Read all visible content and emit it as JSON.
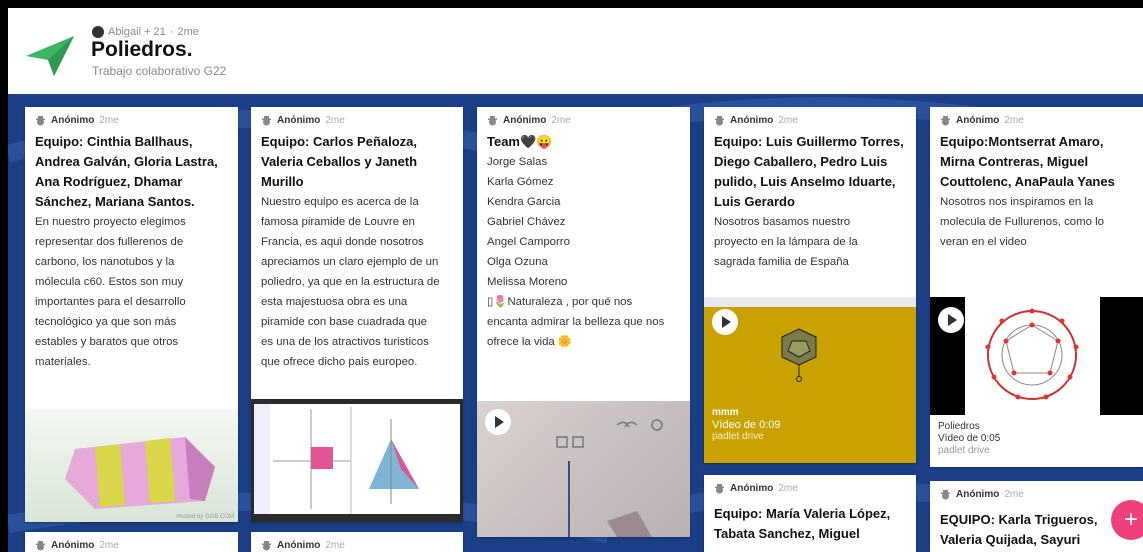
{
  "header": {
    "author": "Abigail + 21",
    "time": "2me",
    "title": "Poliedros.",
    "subtitle": "Trabajo colaborativo G22"
  },
  "cards": [
    {
      "author": "Anónimo",
      "time": "2me",
      "title_lines": [
        "Equipo: Cinthia Ballhaus,",
        "Andrea Galván, Gloria Lastra,",
        "Ana Rodríguez, Dhamar",
        "Sánchez, Mariana Santos."
      ],
      "body_lines": [
        "En nuestro proyecto elegimos",
        "representar dos fullerenos de",
        "carbono, los nanotubos y la",
        "mólecula c60. Estos son muy",
        "importantes para el desarrollo",
        "tecnológico ya que son más",
        "estables y baratos que otros",
        "materiales."
      ],
      "watermark": "Hosted by GGB.COM"
    },
    {
      "author": "Anónimo",
      "time": "2me",
      "title_lines": [
        "Equipo: Carlos Peñaloza,",
        "Valeria Ceballos y Janeth",
        "Murillo"
      ],
      "body_lines": [
        "Nuestro equipo es acerca de la",
        "famosa piramide de Louvre en",
        "Francia, es aqui donde nosotros",
        "apreciamos un claro ejemplo de un",
        "poliedro, ya que en la estructura de",
        "esta majestuosa obra es una",
        "piramide con base cuadrada que",
        "es una de los atractivos turisticos",
        "que ofrece dicho pais europeo."
      ]
    },
    {
      "author": "Anónimo",
      "time": "2me",
      "title_lines": [
        "Team🖤😛"
      ],
      "body_lines": [
        "Jorge Salas",
        "Karla Gómez",
        "Kendra Garcia",
        "Gabriel Chávez",
        "Angel Camporro",
        "Olga Ozuna",
        "Melissa Moreno",
        "",
        "▯🌷Naturaleza , por qué nos",
        "encanta admirar la belleza que nos",
        "ofrece la vida 🌼"
      ]
    },
    {
      "author": "Anónimo",
      "time": "2me",
      "title_lines": [
        "Equipo: Luis Guillermo Torres,",
        "Diego Caballero, Pedro Luis",
        "pulido, Luis Anselmo Iduarte,",
        "Luis Gerardo"
      ],
      "body_lines": [
        "Nosotros basamos nuestro",
        "proyecto en la lámpara de la",
        "sagrada familia de España"
      ],
      "video": {
        "name": "mmm",
        "duration": "Vídeo de 0:09",
        "source": "padlet drive"
      }
    },
    {
      "author": "Anónimo",
      "time": "2me",
      "title_lines": [
        "Equipo:Montserrat Amaro,",
        "Mirna Contreras, Miguel",
        "Couttolenc, AnaPaula Yanes"
      ],
      "body_lines": [
        "Nosotros nos inspiramos en la",
        "molecula de Fullurenos, como lo",
        "veran en el video"
      ],
      "video": {
        "name": "Poliedros",
        "duration": "Vídeo de 0:05",
        "source": "padlet drive"
      }
    },
    {
      "author": "Anónimo",
      "time": "2me",
      "title_lines": [
        "Equipo: María Valeria López,",
        "Tabata Sanchez, Miguel"
      ]
    },
    {
      "author": "Anónimo",
      "time": "2me",
      "title_lines": [
        "EQUIPO: Karla Trigueros,",
        "Valeria Quijada, Sayuri"
      ]
    },
    {
      "author": "Anónimo",
      "time": "2me"
    },
    {
      "author": "Anónimo",
      "time": "2me"
    }
  ],
  "fab": {
    "label": "+"
  },
  "colors": {
    "background": "#1b3f86",
    "logo": "#3cb563",
    "fab": "#f0407a",
    "video_bg": "#c9a200"
  }
}
